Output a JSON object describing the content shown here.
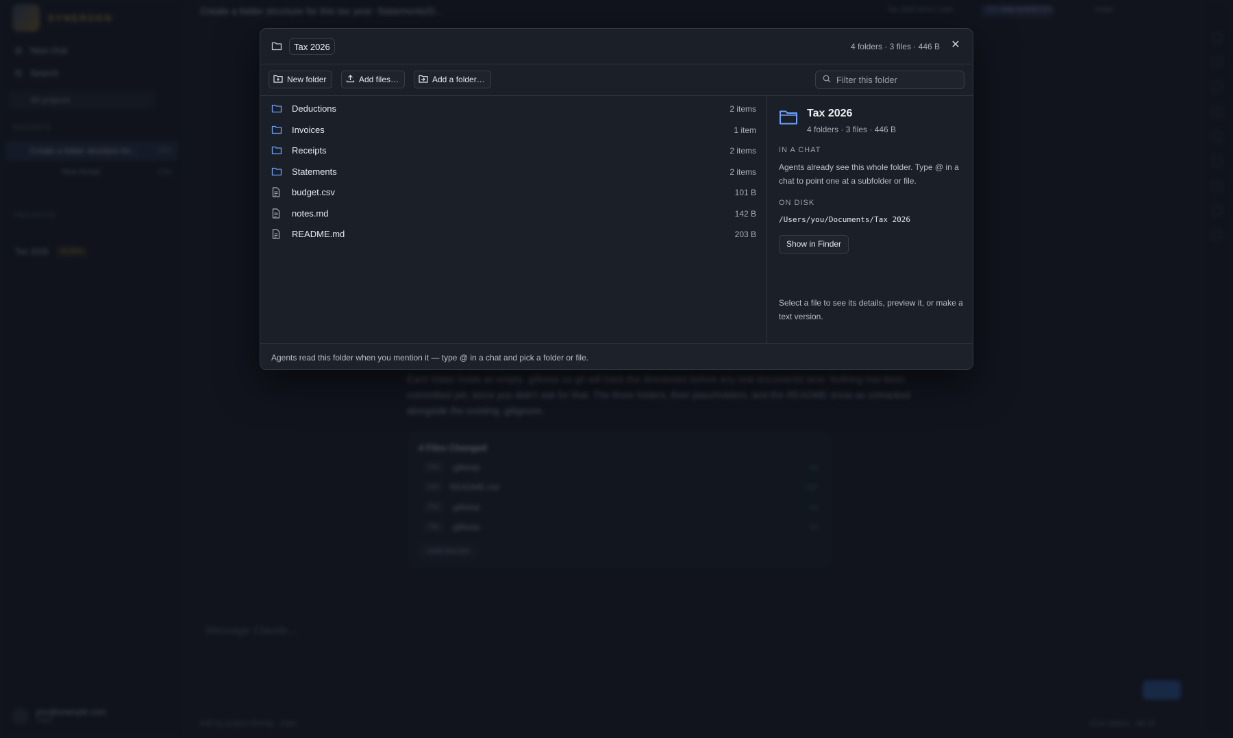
{
  "background": {
    "brand": "SYNERGEN",
    "sidebar": {
      "new_chat": "New chat",
      "search": "Search",
      "filter": "All projects",
      "recents_label": "RECENTS",
      "recent_item": "Create a folder structure for...",
      "recent_item_meta": "12m",
      "sub_item": "New thread",
      "sub_item_meta": "10m",
      "projects_label": "PROJECTS",
      "project_name": "Tax 2026",
      "project_badge": "11 files",
      "user_email": "you@example.com",
      "user_plan": "Team"
    },
    "topbar": {
      "title": "Create a folder structure for this tax year: Statements/D...",
      "badge": "EDITING SUBJECT",
      "meta1": "Tax 2026 demo: main",
      "meta2": "Save to VS Code",
      "meta3": "Finder"
    },
    "chat": {
      "para1": "Each folder holds an empty .gitkeep so git will track the directories before any real documents land. Nothing has been",
      "para2": "committed yet, since you didn't ask for that. The three folders, their placeholders, and the README show as untracked",
      "para3": "alongside the existing .gitignore.",
      "files_card_title": "4 Files Changed",
      "files": [
        {
          "tag": "Tax",
          "name": ".gitkeep",
          "stat": "+0"
        },
        {
          "tag": "md",
          "name": "README.md",
          "stat": "+37"
        },
        {
          "tag": "Tax",
          "name": ".gitkeep",
          "stat": "+0"
        },
        {
          "tag": "Tax",
          "name": ".gitkeep",
          "stat": "+0"
        }
      ],
      "files_card_button": "Undo this turn",
      "composer_placeholder": "Message Claude...",
      "status_left": "Edit by project directly · main",
      "status_right": "222k tokens · $0.20"
    }
  },
  "modal": {
    "title": "Tax 2026",
    "summary": "4 folders · 3 files · 446 B",
    "close_label": "✕",
    "toolbar": {
      "new_folder": "New folder",
      "add_files": "Add files…",
      "add_folder": "Add a folder…",
      "filter_placeholder": "Filter this folder"
    },
    "items": [
      {
        "kind": "folder",
        "name": "Deductions",
        "size": "2 items"
      },
      {
        "kind": "folder",
        "name": "Invoices",
        "size": "1 item"
      },
      {
        "kind": "folder",
        "name": "Receipts",
        "size": "2 items"
      },
      {
        "kind": "folder",
        "name": "Statements",
        "size": "2 items"
      },
      {
        "kind": "file",
        "name": "budget.csv",
        "size": "101 B"
      },
      {
        "kind": "file",
        "name": "notes.md",
        "size": "142 B"
      },
      {
        "kind": "file",
        "name": "README.md",
        "size": "203 B"
      }
    ],
    "details": {
      "name": "Tax 2026",
      "summary": "4 folders · 3 files · 446 B",
      "in_chat_label": "IN A CHAT",
      "in_chat_text": "Agents already see this whole folder. Type @ in a chat to point one at a subfolder or file.",
      "on_disk_label": "ON DISK",
      "path": "/Users/you/Documents/Tax 2026",
      "show_button": "Show in Finder",
      "hint": "Select a file to see its details, preview it, or make a text version."
    },
    "footer": "Agents read this folder when you mention it — type @ in a chat and pick a folder or file."
  },
  "colors": {
    "accent_blue": "#6ea2ff",
    "modal_bg": "#1b1f27",
    "app_bg": "#161b25"
  }
}
